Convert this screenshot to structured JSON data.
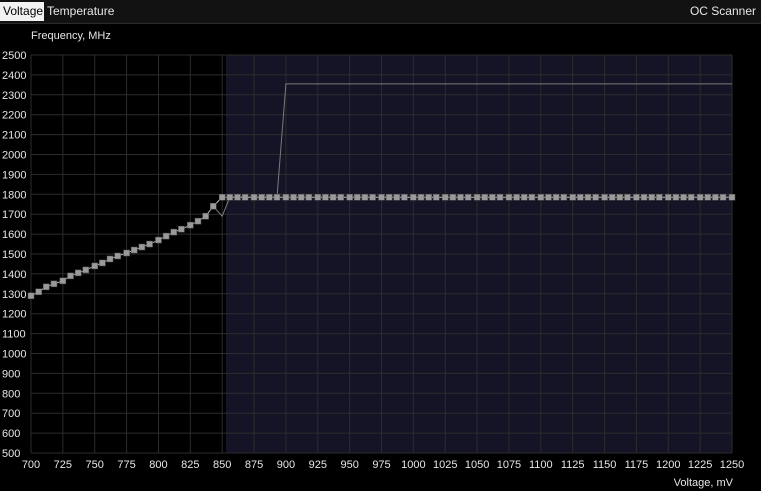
{
  "tabs": {
    "voltage": "Voltage",
    "temperature": "Temperature",
    "oc_scanner": "OC Scanner"
  },
  "colors": {
    "background": "#000000",
    "locked_region": "#141426",
    "grid": "#2c2c2c",
    "curve": "#bcbcbc",
    "points": "#9a9a9a",
    "target_line": "#7a7a7a"
  },
  "chart_data": {
    "type": "line",
    "xlabel": "Voltage, mV",
    "ylabel": "Frequency, MHz",
    "xlim": [
      700,
      1250
    ],
    "ylim": [
      500,
      2500
    ],
    "x_ticks": [
      700,
      725,
      750,
      775,
      800,
      825,
      850,
      875,
      900,
      925,
      950,
      975,
      1000,
      1025,
      1050,
      1075,
      1100,
      1125,
      1150,
      1175,
      1200,
      1225,
      1250
    ],
    "y_ticks": [
      500,
      600,
      700,
      800,
      900,
      1000,
      1100,
      1200,
      1300,
      1400,
      1500,
      1600,
      1700,
      1800,
      1900,
      2000,
      2100,
      2200,
      2300,
      2400,
      2500
    ],
    "grid": true,
    "locked_region_x": [
      853,
      1250
    ],
    "series": [
      {
        "x": [
          700,
          706,
          712,
          718,
          725,
          731,
          737,
          743,
          750,
          756,
          762,
          768,
          775,
          781,
          787,
          793,
          800,
          806,
          812,
          818,
          825,
          831,
          837,
          843,
          850,
          856,
          862,
          868,
          875,
          881,
          887,
          893,
          900,
          906,
          912,
          918,
          925,
          931,
          937,
          943,
          950,
          956,
          962,
          968,
          975,
          981,
          987,
          993,
          1000,
          1006,
          1012,
          1018,
          1025,
          1031,
          1037,
          1043,
          1050,
          1056,
          1062,
          1068,
          1075,
          1081,
          1087,
          1093,
          1100,
          1106,
          1112,
          1118,
          1125,
          1131,
          1137,
          1143,
          1150,
          1156,
          1162,
          1168,
          1175,
          1181,
          1187,
          1193,
          1200,
          1206,
          1212,
          1218,
          1225,
          1231,
          1237,
          1243,
          1250
        ],
        "y": [
          1290,
          1310,
          1335,
          1350,
          1365,
          1390,
          1405,
          1420,
          1440,
          1455,
          1475,
          1490,
          1505,
          1520,
          1535,
          1550,
          1570,
          1590,
          1610,
          1625,
          1645,
          1665,
          1690,
          1740,
          1785,
          1785,
          1785,
          1785,
          1785,
          1785,
          1785,
          1785,
          1785,
          1785,
          1785,
          1785,
          1785,
          1785,
          1785,
          1785,
          1785,
          1785,
          1785,
          1785,
          1785,
          1785,
          1785,
          1785,
          1785,
          1785,
          1785,
          1785,
          1785,
          1785,
          1785,
          1785,
          1785,
          1785,
          1785,
          1785,
          1785,
          1785,
          1785,
          1785,
          1785,
          1785,
          1785,
          1785,
          1785,
          1785,
          1785,
          1785,
          1785,
          1785,
          1785,
          1785,
          1785,
          1785,
          1785,
          1785,
          1785,
          1785,
          1785,
          1785,
          1785,
          1785,
          1785,
          1785,
          1785
        ]
      },
      {
        "x": [
          843,
          850,
          856,
          893,
          900,
          1250
        ],
        "y": [
          1740,
          1690,
          1785,
          1785,
          2355,
          2355
        ]
      }
    ]
  }
}
